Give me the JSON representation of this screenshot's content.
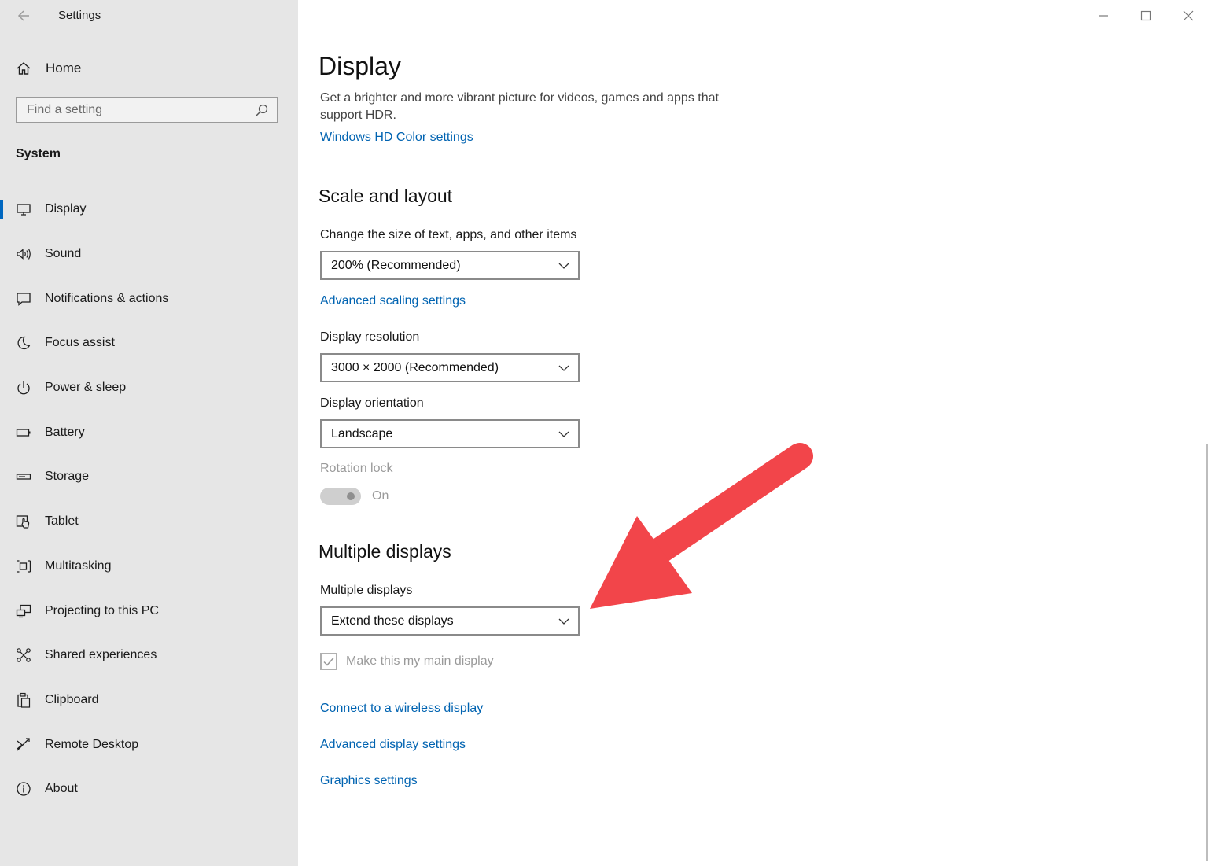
{
  "window": {
    "title": "Settings",
    "controls": [
      "minimize",
      "maximize",
      "close"
    ]
  },
  "sidebar": {
    "home_label": "Home",
    "search_placeholder": "Find a setting",
    "section": "System",
    "items": [
      {
        "label": "Display",
        "icon": "monitor-icon",
        "selected": true
      },
      {
        "label": "Sound",
        "icon": "speaker-icon"
      },
      {
        "label": "Notifications & actions",
        "icon": "notification-icon"
      },
      {
        "label": "Focus assist",
        "icon": "moon-icon"
      },
      {
        "label": "Power & sleep",
        "icon": "power-icon"
      },
      {
        "label": "Battery",
        "icon": "battery-icon"
      },
      {
        "label": "Storage",
        "icon": "storage-icon"
      },
      {
        "label": "Tablet",
        "icon": "tablet-icon"
      },
      {
        "label": "Multitasking",
        "icon": "multitasking-icon"
      },
      {
        "label": "Projecting to this PC",
        "icon": "projecting-icon"
      },
      {
        "label": "Shared experiences",
        "icon": "shared-icon"
      },
      {
        "label": "Clipboard",
        "icon": "clipboard-icon"
      },
      {
        "label": "Remote Desktop",
        "icon": "remote-desktop-icon"
      },
      {
        "label": "About",
        "icon": "info-icon"
      }
    ],
    "accent_color": "#0067c0"
  },
  "main": {
    "title": "Display",
    "hdr_desc": "Get a brighter and more vibrant picture for videos, games and apps that support HDR.",
    "hdr_link": "Windows HD Color settings",
    "scale": {
      "heading": "Scale and layout",
      "size_label": "Change the size of text, apps, and other items",
      "size_value": "200% (Recommended)",
      "advanced_link": "Advanced scaling settings",
      "resolution_label": "Display resolution",
      "resolution_value": "3000 × 2000 (Recommended)",
      "orientation_label": "Display orientation",
      "orientation_value": "Landscape",
      "rotation_label": "Rotation lock",
      "rotation_state": "On"
    },
    "multi": {
      "heading": "Multiple displays",
      "label": "Multiple displays",
      "value": "Extend these displays",
      "main_display_label": "Make this my main display",
      "main_display_checked": true
    },
    "links": {
      "wireless": "Connect to a wireless display",
      "advanced_display": "Advanced display settings",
      "graphics": "Graphics settings"
    },
    "link_color": "#0063b1",
    "annotation_arrow_color": "#f2454a"
  }
}
